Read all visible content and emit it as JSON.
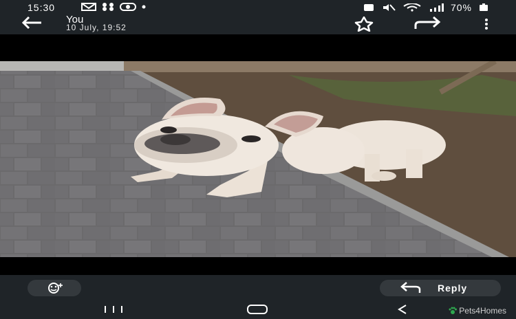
{
  "status_bar": {
    "time": "15:30",
    "battery": "70%",
    "notification_icons": [
      "gmail-icon",
      "pinwheel-icon",
      "spotify-icon",
      "dot-icon"
    ],
    "system_icons": [
      "alarm-icon",
      "mute-icon",
      "wifi-icon",
      "signal-icon",
      "battery-icon"
    ]
  },
  "header": {
    "sender": "You",
    "timestamp": "10 July, 19:52",
    "actions": [
      "back-arrow-icon",
      "star-icon",
      "forward-icon",
      "more-vert-icon"
    ]
  },
  "photo": {
    "subject": "photo-dog-icon"
  },
  "footer": {
    "emoji_icon": "emoji-add-icon",
    "reply_label": "Reply",
    "reply_icon": "reply-arrow-icon"
  },
  "nav_bar": {
    "buttons": [
      "recents-icon",
      "home-icon",
      "back-icon"
    ]
  },
  "watermark": {
    "text": "Pets4Homes",
    "accent": "#2fa84f"
  },
  "colors": {
    "bar": "#1f2428",
    "pill": "#34393d",
    "background": "#000000"
  }
}
